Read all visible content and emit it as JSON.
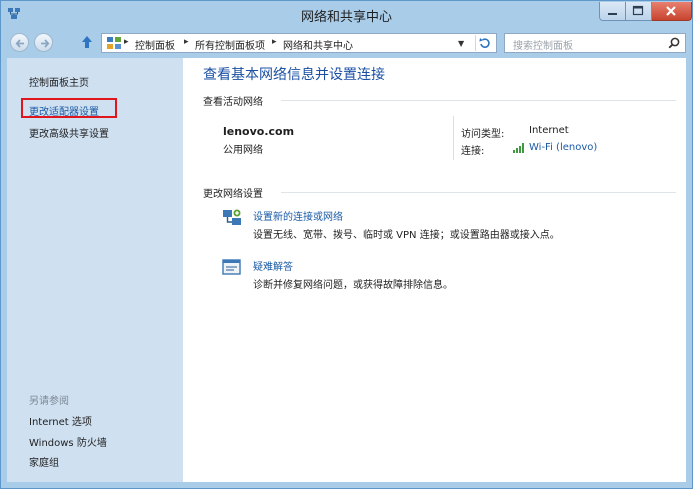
{
  "window": {
    "title": "网络和共享中心"
  },
  "address": {
    "crumbs": [
      "控制面板",
      "所有控制面板项",
      "网络和共享中心"
    ],
    "search_placeholder": "搜索控制面板"
  },
  "sidebar": {
    "home": "控制面板主页",
    "change_adapter": "更改适配器设置",
    "change_sharing": "更改高级共享设置",
    "see_also_title": "另请参阅",
    "see_also": [
      "Internet 选项",
      "Windows 防火墙",
      "家庭组"
    ]
  },
  "main": {
    "title": "查看基本网络信息并设置连接",
    "active_networks_head": "查看活动网络",
    "network_name": "lenovo.com",
    "network_category": "公用网络",
    "access_type_label": "访问类型:",
    "access_type_value": "Internet",
    "connections_label": "连接:",
    "connections_value": "Wi-Fi (lenovo)",
    "change_settings_head": "更改网络设置",
    "tasks": [
      {
        "title": "设置新的连接或网络",
        "desc": "设置无线、宽带、拨号、临时或 VPN 连接；或设置路由器或接入点。"
      },
      {
        "title": "疑难解答",
        "desc": "诊断并修复网络问题，或获得故障排除信息。"
      }
    ]
  },
  "colors": {
    "accent_link": "#1a5aa6",
    "highlight_box": "#e0161c",
    "sidebar_bg": "#cfe0f1",
    "frame": "#a9cce9"
  },
  "icons": [
    "network-icon",
    "minimize-icon",
    "maximize-icon",
    "close-icon",
    "back-arrow-icon",
    "forward-arrow-icon",
    "up-arrow-icon",
    "control-panel-icon",
    "chevron-down-icon",
    "refresh-icon",
    "search-icon",
    "wifi-signal-icon",
    "new-connection-icon",
    "troubleshoot-icon"
  ]
}
